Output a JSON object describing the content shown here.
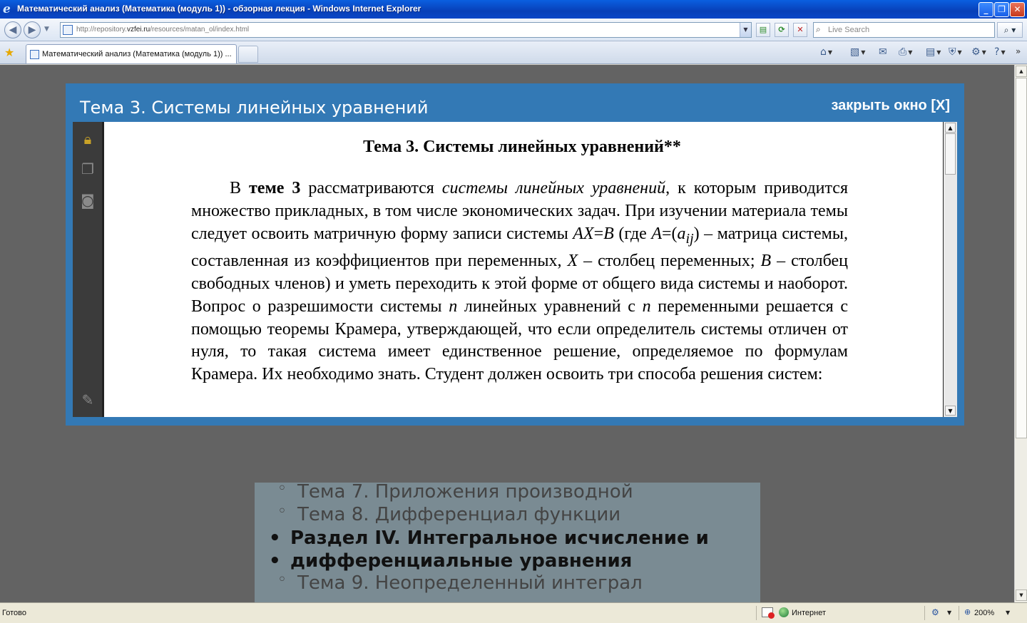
{
  "window": {
    "title": "Математический анализ (Математика (модуль 1)) - обзорная лекция - Windows Internet Explorer",
    "minimize": "_",
    "maximize": "❐",
    "close": "✕"
  },
  "addressbar": {
    "url_prefix": "http://repository.",
    "url_host": "vzfei.ru",
    "url_path": "/resources/matan_ol/index.html",
    "search_placeholder": "Live Search",
    "back": "◀",
    "forward": "▶"
  },
  "tabs": [
    {
      "label": "Математический анализ (Математика (модуль 1)) ..."
    }
  ],
  "lightbox": {
    "title": "Тема 3. Системы линейных уравнений",
    "close_label": "закрыть окно [X]"
  },
  "document": {
    "heading": "Тема 3. Системы линейных уравнений**"
  },
  "background_list": {
    "items": [
      {
        "kind": "sub",
        "text": "Тема 7. Приложения производной"
      },
      {
        "kind": "sub",
        "text": "Тема 8. Дифференциал функции"
      },
      {
        "kind": "section",
        "text": "Раздел IV. Интегральное исчисление и"
      },
      {
        "kind": "section",
        "text": "дифференциальные уравнения"
      },
      {
        "kind": "sub",
        "text": "Тема 9. Неопределенный интеграл"
      }
    ]
  },
  "statusbar": {
    "status": "Готово",
    "zone": "Интернет",
    "zoom": "200%"
  },
  "colors": {
    "lightbox_bg": "#3379b5",
    "overlay_bg": "#636363"
  }
}
